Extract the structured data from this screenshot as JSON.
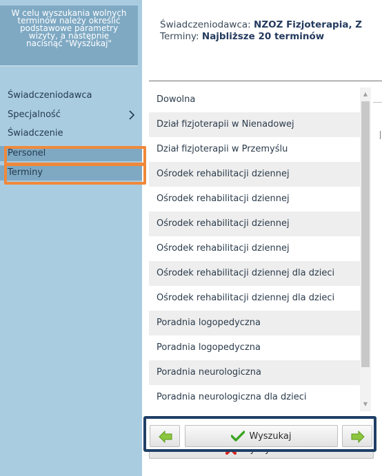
{
  "sidebar": {
    "hint_lines": [
      "W celu wyszukania wolnych",
      "terminów należy określić",
      "podstawowe parametry",
      "wizyty, a następnie",
      "nacisnąć \"Wyszukaj\""
    ],
    "items": [
      {
        "label": "Świadczeniodawca"
      },
      {
        "label": "Specjalność"
      },
      {
        "label": "Świadczenie"
      },
      {
        "label": "Personel"
      },
      {
        "label": "Terminy"
      }
    ],
    "highlight_color": "#f0883a"
  },
  "header": {
    "provider_label": "Świadczeniodawca:",
    "provider_value": "NZOZ Fizjoterapia, Z",
    "terms_label": "Terminy:",
    "terms_value": "Najbliższe 20 terminów"
  },
  "list": {
    "items": [
      "Dowolna",
      "Dział fizjoterapii w Nienadowej",
      "Dział fizjoterapii w Przemyślu",
      "Ośrodek rehabilitacji dziennej",
      "Ośrodek rehabilitacji dziennej",
      "Ośrodek rehabilitacji dziennej",
      "Ośrodek rehabilitacji dziennej",
      "Ośrodek rehabilitacji dziennej dla dzieci",
      "Ośrodek rehabilitacji dziennej dla dzieci",
      "Poradnia logopedyczna",
      "Poradnia logopedyczna",
      "Poradnia neurologiczna",
      "Poradnia neurologiczna dla dzieci"
    ]
  },
  "actions": {
    "search_label": "Wyszukaj",
    "clear_label": "Wyczyść filtr",
    "frame_color": "#1f3f66",
    "prev_icon": "left-arrow-icon",
    "next_icon": "right-arrow-icon",
    "search_icon": "check-icon",
    "clear_icon": "red-x-icon"
  }
}
